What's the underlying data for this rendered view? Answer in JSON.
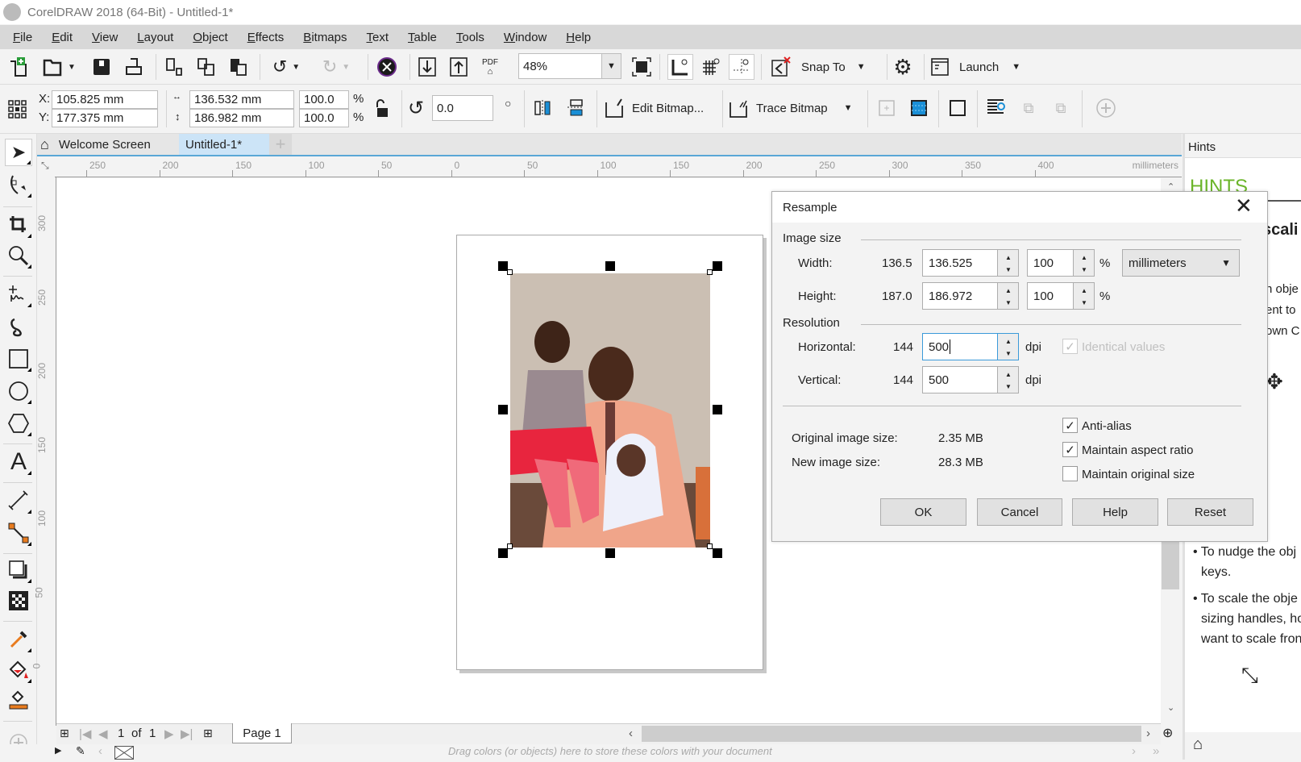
{
  "window": {
    "title": "CorelDRAW 2018 (64-Bit) - Untitled-1*"
  },
  "menu": [
    "File",
    "Edit",
    "View",
    "Layout",
    "Object",
    "Effects",
    "Bitmaps",
    "Text",
    "Table",
    "Tools",
    "Window",
    "Help"
  ],
  "toolbar": {
    "zoom_level": "48%",
    "snap_to_label": "Snap To",
    "launch_label": "Launch",
    "pdf_label": "PDF"
  },
  "property_bar": {
    "x_label": "X:",
    "x_value": "105.825 mm",
    "y_label": "Y:",
    "y_value": "177.375 mm",
    "width_value": "136.532 mm",
    "height_value": "186.982 mm",
    "scale_w": "100.0",
    "scale_h": "100.0",
    "percent": "%",
    "rotation": "0.0",
    "edit_bitmap_label": "Edit Bitmap...",
    "trace_bitmap_label": "Trace Bitmap"
  },
  "doc_tabs": [
    {
      "label": "Welcome Screen",
      "active": false
    },
    {
      "label": "Untitled-1*",
      "active": true
    }
  ],
  "rulers": {
    "unit": "millimeters",
    "h_ticks": [
      "250",
      "200",
      "150",
      "100",
      "50",
      "0",
      "50",
      "100",
      "150",
      "200",
      "250",
      "300",
      "350",
      "400"
    ],
    "v_ticks": [
      "300",
      "250",
      "200",
      "150",
      "100",
      "50",
      "0"
    ]
  },
  "page_nav": {
    "current": "1",
    "of_label": "of",
    "total": "1",
    "page_tab": "Page 1"
  },
  "palette_hint": "Drag colors (or objects) here to store these colors with your document",
  "hints_panel": {
    "tab_label": "Hints",
    "heading": "HINTS",
    "subheading": "scali",
    "fragments": [
      "n obje",
      "ent to",
      "own C"
    ],
    "bullets": [
      [
        "To nudge the obj",
        "keys."
      ],
      [
        "To scale the obje",
        "sizing handles, ho",
        "want to scale fron"
      ]
    ]
  },
  "resample_dialog": {
    "title": "Resample",
    "image_size_label": "Image size",
    "width_label": "Width:",
    "width_original": "136.5",
    "width_value": "136.525",
    "width_percent": "100",
    "height_label": "Height:",
    "height_original": "187.0",
    "height_value": "186.972",
    "height_percent": "100",
    "percent_sign": "%",
    "units": "millimeters",
    "resolution_label": "Resolution",
    "horizontal_label": "Horizontal:",
    "horizontal_original": "144",
    "horizontal_value": "500",
    "vertical_label": "Vertical:",
    "vertical_original": "144",
    "vertical_value": "500",
    "dpi": "dpi",
    "identical_values_label": "Identical values",
    "identical_values_checked": true,
    "identical_values_enabled": false,
    "original_size_label": "Original image size:",
    "original_size_value": "2.35 MB",
    "new_size_label": "New image size:",
    "new_size_value": "28.3 MB",
    "anti_alias_label": "Anti-alias",
    "anti_alias_checked": true,
    "maintain_aspect_label": "Maintain aspect ratio",
    "maintain_aspect_checked": true,
    "maintain_original_label": "Maintain original size",
    "maintain_original_checked": false,
    "buttons": {
      "ok": "OK",
      "cancel": "Cancel",
      "help": "Help",
      "reset": "Reset"
    }
  }
}
